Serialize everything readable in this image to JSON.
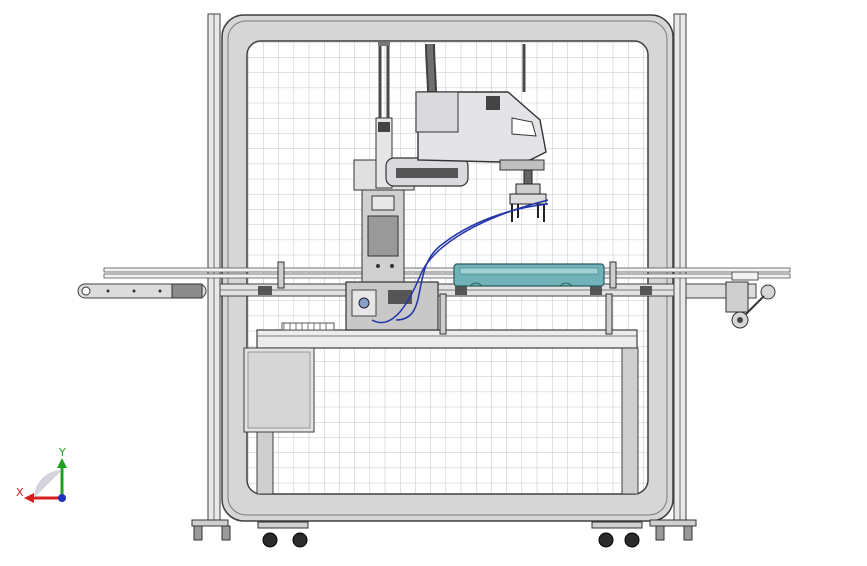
{
  "viewport": {
    "background": "#ffffff",
    "description_colors": {
      "frame": "#6f6f6f",
      "frame_dark": "#3f3f3f",
      "glass_grid": "#a9b3bf",
      "robot_body": "#d9d9de",
      "robot_dark": "#4a4a4a",
      "tray_fill": "#6fb3b8",
      "hose": "#2233aa",
      "metal_light": "#cfcfcf"
    }
  },
  "triad": {
    "x_label": "X",
    "y_label": "Y",
    "x_color": "#d42020",
    "y_color": "#20a020",
    "z_color": "#2030c0"
  }
}
